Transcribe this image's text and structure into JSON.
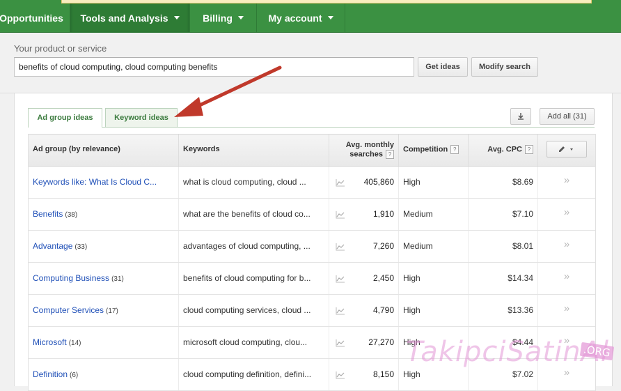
{
  "nav": {
    "items": [
      {
        "label": "Opportunities"
      },
      {
        "label": "Tools and Analysis"
      },
      {
        "label": "Billing"
      },
      {
        "label": "My account"
      }
    ]
  },
  "search": {
    "label": "Your product or service",
    "value": "benefits of cloud computing, cloud computing benefits",
    "get_ideas": "Get ideas",
    "modify_search": "Modify search"
  },
  "tabs": [
    {
      "label": "Ad group ideas",
      "active": true
    },
    {
      "label": "Keyword ideas",
      "active": false
    }
  ],
  "toolbar": {
    "download_icon": "download-icon",
    "add_all": "Add all (31)"
  },
  "table": {
    "headers": {
      "group": "Ad group (by relevance)",
      "keywords": "Keywords",
      "searches_line1": "Avg. monthly",
      "searches_line2": "searches",
      "competition": "Competition",
      "cpc": "Avg. CPC",
      "help": "?"
    },
    "rows": [
      {
        "group": "Keywords like: What Is Cloud C...",
        "count": "",
        "keywords": "what is cloud computing, cloud ...",
        "searches": "405,860",
        "competition": "High",
        "cpc": "$8.69"
      },
      {
        "group": "Benefits",
        "count": "(38)",
        "keywords": "what are the benefits of cloud co...",
        "searches": "1,910",
        "competition": "Medium",
        "cpc": "$7.10"
      },
      {
        "group": "Advantage",
        "count": "(33)",
        "keywords": "advantages of cloud computing, ...",
        "searches": "7,260",
        "competition": "Medium",
        "cpc": "$8.01"
      },
      {
        "group": "Computing Business",
        "count": "(31)",
        "keywords": "benefits of cloud computing for b...",
        "searches": "2,450",
        "competition": "High",
        "cpc": "$14.34"
      },
      {
        "group": "Computer Services",
        "count": "(17)",
        "keywords": "cloud computing services, cloud ...",
        "searches": "4,790",
        "competition": "High",
        "cpc": "$13.36"
      },
      {
        "group": "Microsoft",
        "count": "(14)",
        "keywords": "microsoft cloud computing, clou...",
        "searches": "27,270",
        "competition": "High",
        "cpc": "$4.44"
      },
      {
        "group": "Definition",
        "count": "(6)",
        "keywords": "cloud computing definition, defini...",
        "searches": "8,150",
        "competition": "High",
        "cpc": "$7.02"
      }
    ]
  },
  "watermark": {
    "text": "TakipciSatinAl",
    "suffix": ".ORG"
  },
  "colors": {
    "nav_bg": "#3b9142",
    "link": "#2151b8",
    "arrow": "#c0392b"
  }
}
